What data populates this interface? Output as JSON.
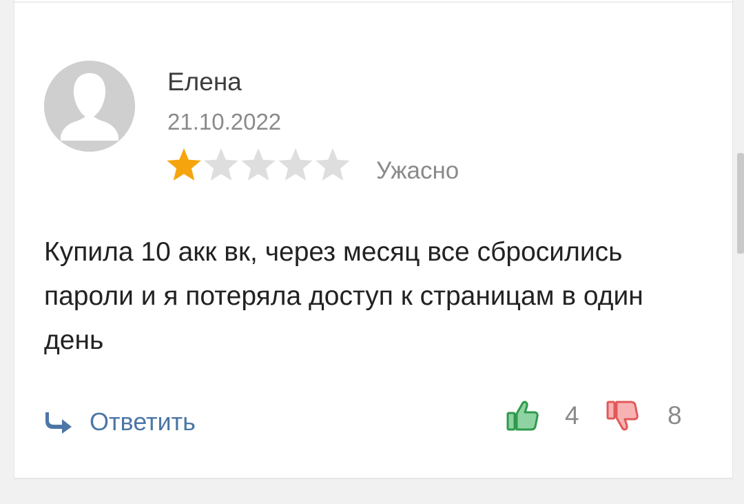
{
  "review": {
    "author": "Елена",
    "date": "21.10.2022",
    "rating": {
      "value": 1,
      "max": 5,
      "label": "Ужасно"
    },
    "text": "Купила 10 акк вк, через месяц все сбросились пароли и я потеряла доступ к страницам в один день",
    "reply_label": "Ответить",
    "likes": "4",
    "dislikes": "8"
  },
  "icons": {
    "avatar": "user-silhouette-icon",
    "star_filled": "star-filled-icon",
    "star_empty": "star-empty-icon",
    "reply": "reply-arrow-icon",
    "like": "thumbs-up-icon",
    "dislike": "thumbs-down-icon"
  },
  "colors": {
    "star_filled": "#f6a40d",
    "star_empty": "#dedede",
    "reply": "#4c76a6",
    "like": "#2e9a4b",
    "like_fill": "#8fd3a3",
    "dislike": "#e25858",
    "dislike_fill": "#f7b3b3",
    "avatar_bg": "#cfcfcf"
  }
}
